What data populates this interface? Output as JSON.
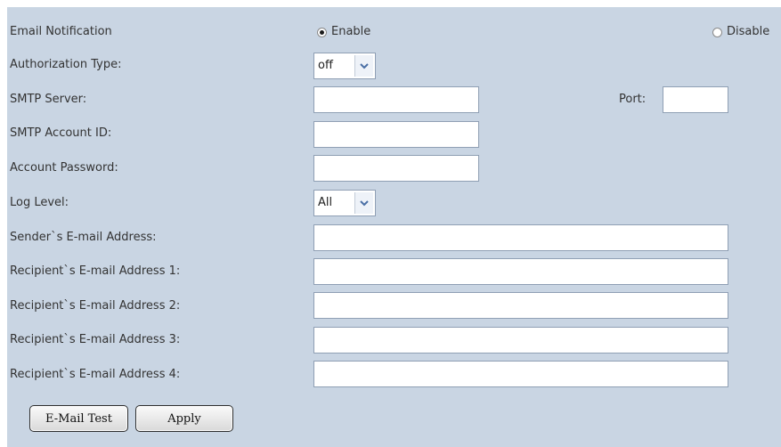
{
  "email_notification": {
    "label": "Email Notification",
    "enable_label": "Enable",
    "disable_label": "Disable",
    "selected": "Enable"
  },
  "authorization_type": {
    "label": "Authorization Type:",
    "value": "off"
  },
  "smtp_server": {
    "label": "SMTP Server:",
    "value": ""
  },
  "port": {
    "label": "Port:",
    "value": ""
  },
  "smtp_account_id": {
    "label": "SMTP Account ID:",
    "value": ""
  },
  "account_password": {
    "label": "Account Password:",
    "value": ""
  },
  "log_level": {
    "label": "Log Level:",
    "value": "All"
  },
  "sender_email": {
    "label": "Sender`s E-mail Address:",
    "value": ""
  },
  "recipients": [
    {
      "label": "Recipient`s E-mail Address 1:",
      "value": ""
    },
    {
      "label": "Recipient`s E-mail Address 2:",
      "value": ""
    },
    {
      "label": "Recipient`s E-mail Address 3:",
      "value": ""
    },
    {
      "label": "Recipient`s E-mail Address 4:",
      "value": ""
    }
  ],
  "buttons": {
    "email_test": "E-Mail Test",
    "apply": "Apply"
  }
}
